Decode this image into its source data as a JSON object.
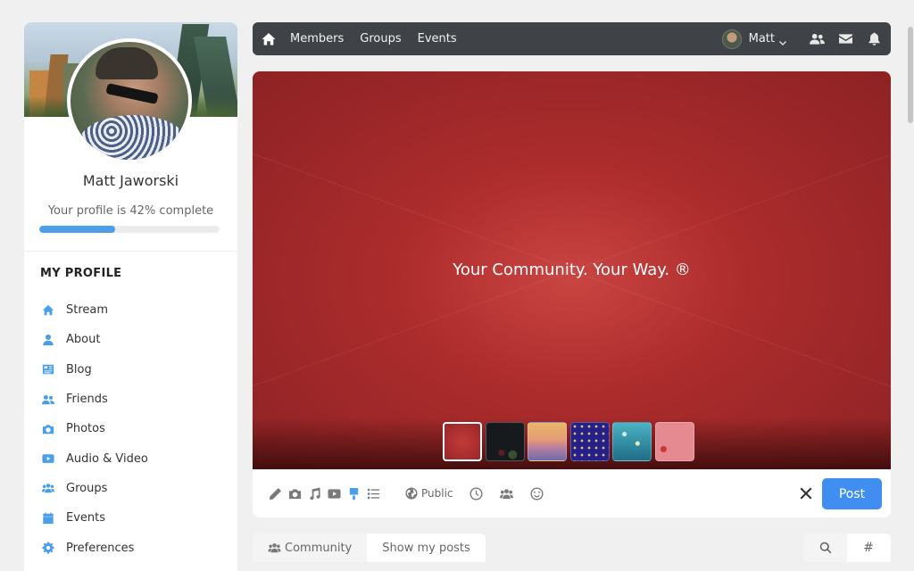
{
  "sidebar": {
    "profile_name": "Matt Jaworski",
    "profile_complete_text": "Your profile is 42% complete",
    "profile_complete_percent": 42,
    "section_title": "MY PROFILE",
    "items": [
      {
        "label": "Stream",
        "icon": "home-icon"
      },
      {
        "label": "About",
        "icon": "user-icon"
      },
      {
        "label": "Blog",
        "icon": "blog-icon"
      },
      {
        "label": "Friends",
        "icon": "friends-icon"
      },
      {
        "label": "Photos",
        "icon": "camera-icon"
      },
      {
        "label": "Audio & Video",
        "icon": "video-icon"
      },
      {
        "label": "Groups",
        "icon": "groups-icon"
      },
      {
        "label": "Events",
        "icon": "calendar-icon"
      },
      {
        "label": "Preferences",
        "icon": "gear-icon"
      }
    ]
  },
  "topbar": {
    "nav": [
      "Members",
      "Groups",
      "Events"
    ],
    "user_name": "Matt"
  },
  "composer": {
    "banner_text": "Your Community. Your Way. ®",
    "visibility_label": "Public",
    "post_label": "Post",
    "backgrounds": [
      "red",
      "dark-flowers",
      "sunset",
      "stars",
      "teal",
      "pink"
    ],
    "selected_background": 0
  },
  "filters": {
    "community_label": "Community",
    "my_posts_label": "Show my posts",
    "hash_label": "#"
  },
  "colors": {
    "accent": "#4a9fe8",
    "post_button": "#3f8ef0",
    "topbar": "#3f4246",
    "banner": "#a92a2b"
  }
}
